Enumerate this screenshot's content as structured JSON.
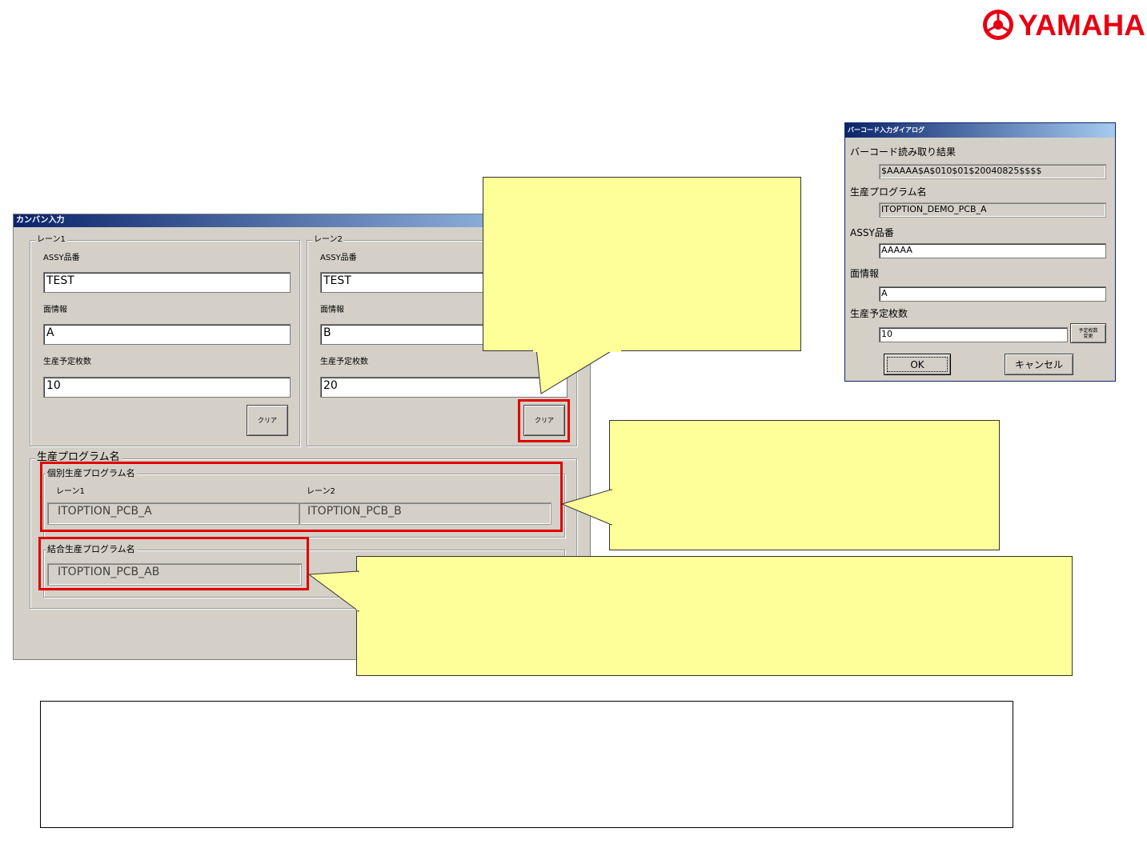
{
  "brand": {
    "logo_text": "YAMAHA"
  },
  "kanban_window": {
    "title": "カンバン入力",
    "lane1": {
      "group_title": "レーン1",
      "assy_label": "ASSY品番",
      "assy_value": "TEST",
      "face_label": "面情報",
      "face_value": "A",
      "qty_label": "生産予定枚数",
      "qty_value": "10",
      "clear_button": "クリア"
    },
    "lane2": {
      "group_title": "レーン2",
      "assy_label": "ASSY品番",
      "assy_value": "TEST",
      "face_label": "面情報",
      "face_value": "B",
      "qty_label": "生産予定枚数",
      "qty_value": "20",
      "clear_button": "クリア"
    },
    "program_group": {
      "title": "生産プログラム名",
      "individual": {
        "title": "個別生産プログラム名",
        "lane1_label": "レーン1",
        "lane1_value": "ITOPTION_PCB_A",
        "lane2_label": "レーン2",
        "lane2_value": "ITOPTION_PCB_B"
      },
      "combined": {
        "title": "結合生産プログラム名",
        "value": "ITOPTION_PCB_AB"
      }
    }
  },
  "barcode_dialog": {
    "title": "バーコード入力ダイアログ",
    "result_label": "バーコード読み取り結果",
    "result_value": "$AAAAA$A$010$01$20040825$$$$",
    "program_label": "生産プログラム名",
    "program_value": "ITOPTION_DEMO_PCB_A",
    "assy_label": "ASSY品番",
    "assy_value": "AAAAA",
    "face_label": "面情報",
    "face_value": "A",
    "qty_label": "生産予定枚数",
    "qty_value": "10",
    "qty_change_button": "予定枚数\n変更",
    "ok_button": "OK",
    "cancel_button": "キャンセル"
  },
  "colors": {
    "highlight": "#e00000",
    "callout_fill": "#ffff99",
    "window_face": "#d4d0c8",
    "title_gradient_start": "#0a246a",
    "title_gradient_end": "#a6caf0",
    "brand": "#e60012"
  }
}
